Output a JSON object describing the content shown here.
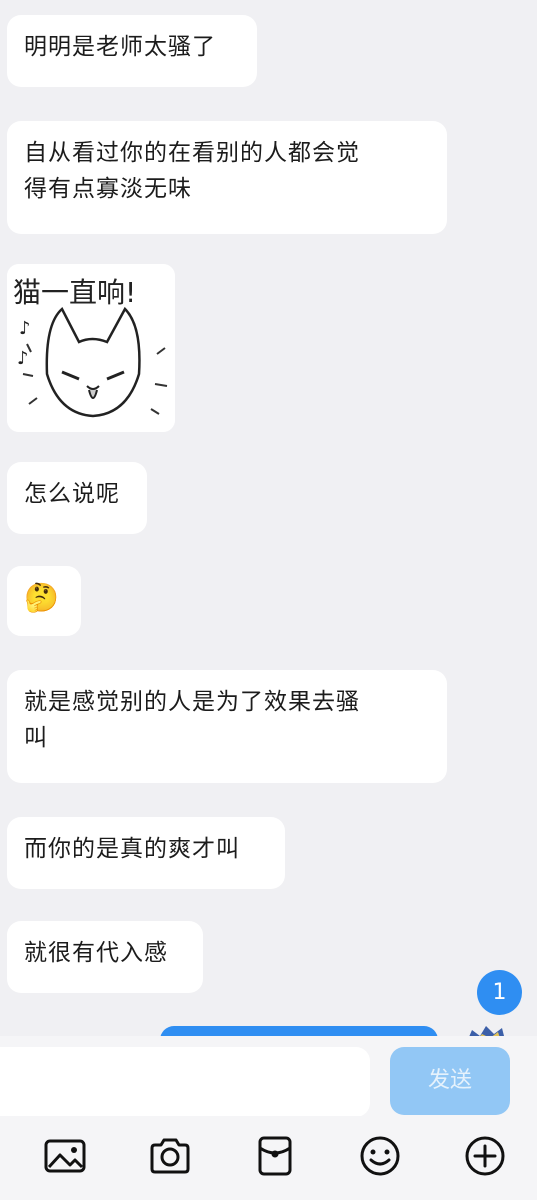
{
  "messages": [
    {
      "text": "明明是老师太骚了"
    },
    {
      "line1": "自从看过你的在看别的人都会觉",
      "line2": "得有点寡淡无味"
    },
    {
      "sticker_text": "猫一直响!"
    },
    {
      "text": "怎么说呢"
    },
    {
      "emoji": "🤔"
    },
    {
      "line1": "就是感觉别的人是为了效果去骚",
      "line2": "叫"
    },
    {
      "text": "而你的是真的爽才叫"
    },
    {
      "text": "就很有代入感"
    }
  ],
  "unread_badge": "1",
  "composer": {
    "placeholder": "",
    "send_label": "发送"
  },
  "toolbar": [
    {
      "icon": "image-icon"
    },
    {
      "icon": "camera-icon"
    },
    {
      "icon": "red-packet-icon"
    },
    {
      "icon": "emoji-icon"
    },
    {
      "icon": "plus-icon"
    }
  ],
  "colors": {
    "background": "#f0f0f3",
    "bubble": "#ffffff",
    "accent": "#2f8ef2",
    "send_disabled": "#92c7f5"
  }
}
